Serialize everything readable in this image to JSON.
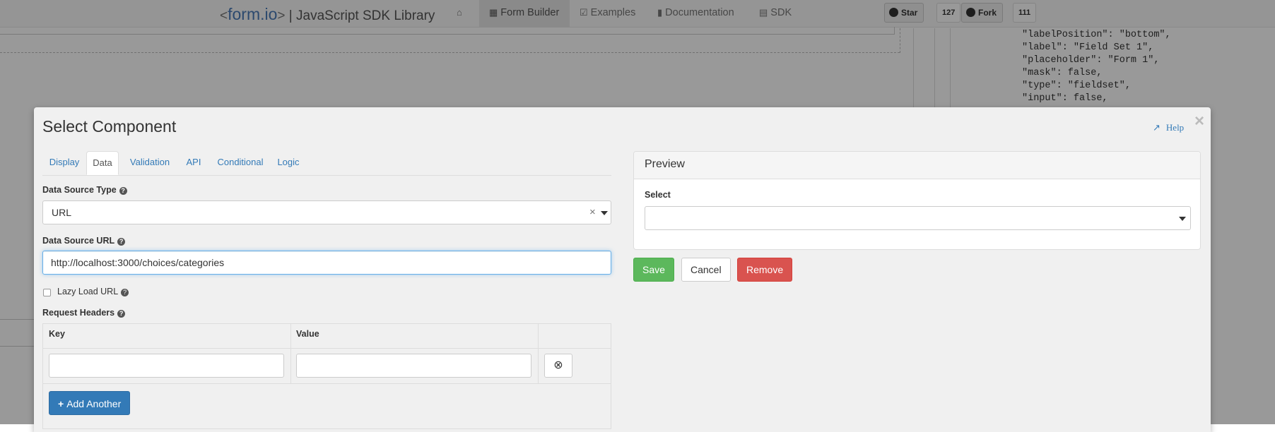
{
  "navbar": {
    "brand_prefix": "<",
    "brand_name": "form.io",
    "brand_suffix": ">",
    "brand_rest": " | JavaScript SDK Library",
    "items": [
      {
        "icon": "home-icon",
        "label": ""
      },
      {
        "icon": "table-icon",
        "label": "Form Builder"
      },
      {
        "icon": "check-square-icon",
        "label": "Examples"
      },
      {
        "icon": "book-icon",
        "label": "Documentation"
      },
      {
        "icon": "list-icon",
        "label": "SDK"
      }
    ],
    "star_label": "Star",
    "star_count": "127",
    "fork_label": "Fork",
    "fork_count": "111"
  },
  "json_panel": {
    "code": "\"labelPosition\": \"bottom\",\n\"label\": \"Field Set 1\",\n\"placeholder\": \"Form 1\",\n\"mask\": false,\n\"type\": \"fieldset\",\n\"input\": false,"
  },
  "modal": {
    "title": "Select Component",
    "help_label": "Help",
    "close_symbol": "×",
    "tabs": [
      {
        "label": "Display"
      },
      {
        "label": "Data"
      },
      {
        "label": "Validation"
      },
      {
        "label": "API"
      },
      {
        "label": "Conditional"
      },
      {
        "label": "Logic"
      }
    ],
    "active_tab": "Data",
    "data_source_type": {
      "label": "Data Source Type",
      "value": "URL",
      "clear_symbol": "×"
    },
    "data_source_url": {
      "label": "Data Source URL",
      "value": "http://localhost:3000/choices/categories"
    },
    "lazy_load": {
      "label": "Lazy Load URL",
      "checked": false
    },
    "request_headers": {
      "label": "Request Headers",
      "columns": [
        "Key",
        "Value",
        ""
      ],
      "rows": [
        {
          "key": "",
          "value": ""
        }
      ],
      "add_label": "Add Another"
    },
    "preview": {
      "title": "Preview",
      "select_label": "Select",
      "select_value": ""
    },
    "buttons": {
      "save": "Save",
      "cancel": "Cancel",
      "remove": "Remove"
    }
  },
  "colors": {
    "primary": "#337ab7",
    "success": "#5cb85c",
    "danger": "#d9534f",
    "brand": "#4a7bb7"
  }
}
